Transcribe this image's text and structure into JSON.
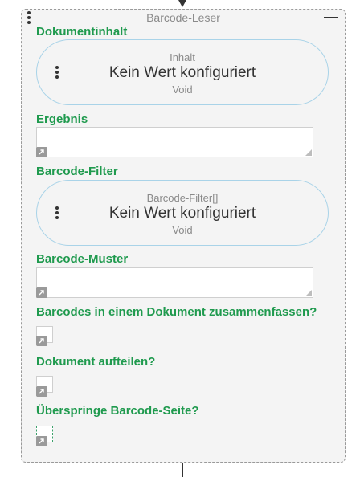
{
  "node": {
    "title": "Barcode-Leser"
  },
  "fields": {
    "document_content": {
      "label": "Dokumentinhalt",
      "type_label": "Inhalt",
      "value_text": "Kein Wert konfiguriert",
      "sub_text": "Void"
    },
    "result": {
      "label": "Ergebnis",
      "value": ""
    },
    "barcode_filter": {
      "label": "Barcode-Filter",
      "type_label": "Barcode-Filter[]",
      "value_text": "Kein Wert konfiguriert",
      "sub_text": "Void"
    },
    "barcode_pattern": {
      "label": "Barcode-Muster",
      "value": ""
    },
    "merge_barcodes": {
      "label": "Barcodes in einem Dokument zusammenfassen?",
      "checked": false
    },
    "split_document": {
      "label": "Dokument aufteilen?",
      "checked": false
    },
    "skip_barcode_page": {
      "label": "Überspringe Barcode-Seite?",
      "checked": false
    }
  },
  "colors": {
    "label_green": "#1f9a4e",
    "pill_border": "#a9d3e8",
    "node_background": "#f4f4f4"
  },
  "icons": {
    "node_menu": "vertical-dots-icon",
    "collapse": "minus-icon",
    "link": "arrow-link-icon",
    "resize": "resize-grip-icon"
  }
}
